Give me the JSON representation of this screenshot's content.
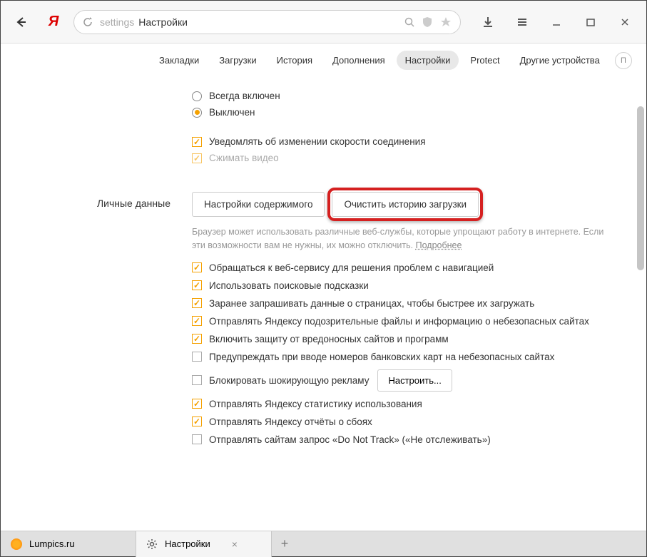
{
  "titlebar": {
    "addr_prefix": "settings",
    "addr_title": "Настройки"
  },
  "nav": {
    "tabs": [
      "Закладки",
      "Загрузки",
      "История",
      "Дополнения",
      "Настройки",
      "Protect",
      "Другие устройства"
    ],
    "active_index": 4,
    "extra": "П"
  },
  "turbo": {
    "opt_always": "Всегда включен",
    "opt_off": "Выключен",
    "chk_notify": "Уведомлять об изменении скорости соединения",
    "chk_compress": "Сжимать видео"
  },
  "personal": {
    "section_label": "Личные данные",
    "btn_content": "Настройки содержимого",
    "btn_clear": "Очистить историю загрузки",
    "desc_text": "Браузер может использовать различные веб-службы, которые упрощают работу в интернете. Если эти возможности вам не нужны, их можно отключить. ",
    "desc_link": "Подробнее",
    "opts": [
      {
        "label": "Обращаться к веб-сервису для решения проблем с навигацией",
        "checked": true
      },
      {
        "label": "Использовать поисковые подсказки",
        "checked": true
      },
      {
        "label": "Заранее запрашивать данные о страницах, чтобы быстрее их загружать",
        "checked": true
      },
      {
        "label": "Отправлять Яндексу подозрительные файлы и информацию о небезопасных сайтах",
        "checked": true
      },
      {
        "label": "Включить защиту от вредоносных сайтов и программ",
        "checked": true
      },
      {
        "label": "Предупреждать при вводе номеров банковских карт на небезопасных сайтах",
        "checked": false
      },
      {
        "label": "Блокировать шокирующую рекламу",
        "checked": false,
        "button": "Настроить..."
      },
      {
        "label": "Отправлять Яндексу статистику использования",
        "checked": true
      },
      {
        "label": "Отправлять Яндексу отчёты о сбоях",
        "checked": true
      },
      {
        "label": "Отправлять сайтам запрос «Do Not Track» («Не отслеживать»)",
        "checked": false
      }
    ]
  },
  "tabs": {
    "tab1": "Lumpics.ru",
    "tab2": "Настройки"
  }
}
